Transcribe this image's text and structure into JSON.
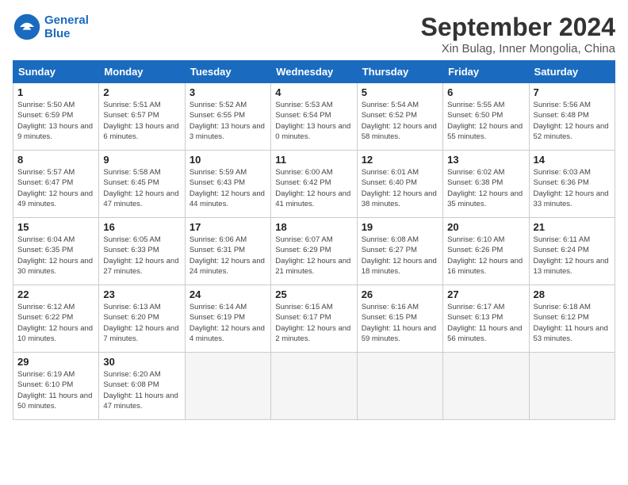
{
  "header": {
    "logo_line1": "General",
    "logo_line2": "Blue",
    "title": "September 2024",
    "subtitle": "Xin Bulag, Inner Mongolia, China"
  },
  "days_of_week": [
    "Sunday",
    "Monday",
    "Tuesday",
    "Wednesday",
    "Thursday",
    "Friday",
    "Saturday"
  ],
  "weeks": [
    [
      {
        "day": "1",
        "info": "Sunrise: 5:50 AM\nSunset: 6:59 PM\nDaylight: 13 hours and 9 minutes."
      },
      {
        "day": "2",
        "info": "Sunrise: 5:51 AM\nSunset: 6:57 PM\nDaylight: 13 hours and 6 minutes."
      },
      {
        "day": "3",
        "info": "Sunrise: 5:52 AM\nSunset: 6:55 PM\nDaylight: 13 hours and 3 minutes."
      },
      {
        "day": "4",
        "info": "Sunrise: 5:53 AM\nSunset: 6:54 PM\nDaylight: 13 hours and 0 minutes."
      },
      {
        "day": "5",
        "info": "Sunrise: 5:54 AM\nSunset: 6:52 PM\nDaylight: 12 hours and 58 minutes."
      },
      {
        "day": "6",
        "info": "Sunrise: 5:55 AM\nSunset: 6:50 PM\nDaylight: 12 hours and 55 minutes."
      },
      {
        "day": "7",
        "info": "Sunrise: 5:56 AM\nSunset: 6:48 PM\nDaylight: 12 hours and 52 minutes."
      }
    ],
    [
      {
        "day": "8",
        "info": "Sunrise: 5:57 AM\nSunset: 6:47 PM\nDaylight: 12 hours and 49 minutes."
      },
      {
        "day": "9",
        "info": "Sunrise: 5:58 AM\nSunset: 6:45 PM\nDaylight: 12 hours and 47 minutes."
      },
      {
        "day": "10",
        "info": "Sunrise: 5:59 AM\nSunset: 6:43 PM\nDaylight: 12 hours and 44 minutes."
      },
      {
        "day": "11",
        "info": "Sunrise: 6:00 AM\nSunset: 6:42 PM\nDaylight: 12 hours and 41 minutes."
      },
      {
        "day": "12",
        "info": "Sunrise: 6:01 AM\nSunset: 6:40 PM\nDaylight: 12 hours and 38 minutes."
      },
      {
        "day": "13",
        "info": "Sunrise: 6:02 AM\nSunset: 6:38 PM\nDaylight: 12 hours and 35 minutes."
      },
      {
        "day": "14",
        "info": "Sunrise: 6:03 AM\nSunset: 6:36 PM\nDaylight: 12 hours and 33 minutes."
      }
    ],
    [
      {
        "day": "15",
        "info": "Sunrise: 6:04 AM\nSunset: 6:35 PM\nDaylight: 12 hours and 30 minutes."
      },
      {
        "day": "16",
        "info": "Sunrise: 6:05 AM\nSunset: 6:33 PM\nDaylight: 12 hours and 27 minutes."
      },
      {
        "day": "17",
        "info": "Sunrise: 6:06 AM\nSunset: 6:31 PM\nDaylight: 12 hours and 24 minutes."
      },
      {
        "day": "18",
        "info": "Sunrise: 6:07 AM\nSunset: 6:29 PM\nDaylight: 12 hours and 21 minutes."
      },
      {
        "day": "19",
        "info": "Sunrise: 6:08 AM\nSunset: 6:27 PM\nDaylight: 12 hours and 18 minutes."
      },
      {
        "day": "20",
        "info": "Sunrise: 6:10 AM\nSunset: 6:26 PM\nDaylight: 12 hours and 16 minutes."
      },
      {
        "day": "21",
        "info": "Sunrise: 6:11 AM\nSunset: 6:24 PM\nDaylight: 12 hours and 13 minutes."
      }
    ],
    [
      {
        "day": "22",
        "info": "Sunrise: 6:12 AM\nSunset: 6:22 PM\nDaylight: 12 hours and 10 minutes."
      },
      {
        "day": "23",
        "info": "Sunrise: 6:13 AM\nSunset: 6:20 PM\nDaylight: 12 hours and 7 minutes."
      },
      {
        "day": "24",
        "info": "Sunrise: 6:14 AM\nSunset: 6:19 PM\nDaylight: 12 hours and 4 minutes."
      },
      {
        "day": "25",
        "info": "Sunrise: 6:15 AM\nSunset: 6:17 PM\nDaylight: 12 hours and 2 minutes."
      },
      {
        "day": "26",
        "info": "Sunrise: 6:16 AM\nSunset: 6:15 PM\nDaylight: 11 hours and 59 minutes."
      },
      {
        "day": "27",
        "info": "Sunrise: 6:17 AM\nSunset: 6:13 PM\nDaylight: 11 hours and 56 minutes."
      },
      {
        "day": "28",
        "info": "Sunrise: 6:18 AM\nSunset: 6:12 PM\nDaylight: 11 hours and 53 minutes."
      }
    ],
    [
      {
        "day": "29",
        "info": "Sunrise: 6:19 AM\nSunset: 6:10 PM\nDaylight: 11 hours and 50 minutes."
      },
      {
        "day": "30",
        "info": "Sunrise: 6:20 AM\nSunset: 6:08 PM\nDaylight: 11 hours and 47 minutes."
      },
      {
        "day": "",
        "info": ""
      },
      {
        "day": "",
        "info": ""
      },
      {
        "day": "",
        "info": ""
      },
      {
        "day": "",
        "info": ""
      },
      {
        "day": "",
        "info": ""
      }
    ]
  ]
}
